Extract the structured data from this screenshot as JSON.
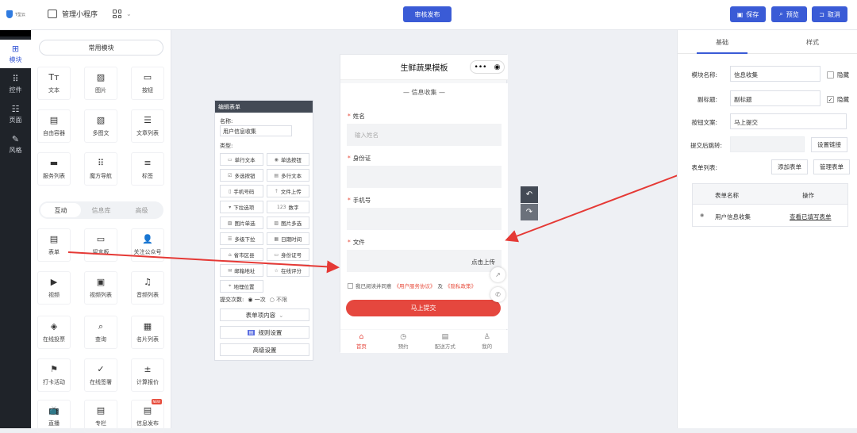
{
  "topbar": {
    "logo_text": "T型云",
    "manage_label": "管理小程序",
    "review_publish_label": "审核发布",
    "save_label": "保存",
    "preview_label": "预览",
    "cancel_label": "取消",
    "accent_color": "#3a5bd6"
  },
  "sidebar": {
    "items": [
      {
        "label": "模块",
        "icon": "plus-square-icon"
      },
      {
        "label": "控件",
        "icon": "grid-icon"
      },
      {
        "label": "页面",
        "icon": "pages-icon"
      },
      {
        "label": "风格",
        "icon": "brush-icon"
      }
    ]
  },
  "modules": {
    "common_label": "常用模块",
    "common": [
      {
        "label": "文本",
        "icon": "text-icon"
      },
      {
        "label": "图片",
        "icon": "image-icon"
      },
      {
        "label": "按钮",
        "icon": "button-icon"
      },
      {
        "label": "自由容器",
        "icon": "container-icon"
      },
      {
        "label": "多图文",
        "icon": "multi-image-icon"
      },
      {
        "label": "文章列表",
        "icon": "article-list-icon"
      },
      {
        "label": "服务列表",
        "icon": "service-list-icon"
      },
      {
        "label": "魔方导航",
        "icon": "cube-nav-icon"
      },
      {
        "label": "标签",
        "icon": "tag-icon"
      }
    ],
    "tabs": [
      "互动",
      "信息库",
      "高级"
    ],
    "interactive": [
      {
        "label": "表单",
        "icon": "form-icon"
      },
      {
        "label": "留言板",
        "icon": "message-icon"
      },
      {
        "label": "关注公众号",
        "icon": "follow-icon"
      },
      {
        "label": "视频",
        "icon": "video-icon"
      },
      {
        "label": "视频列表",
        "icon": "video-list-icon"
      },
      {
        "label": "音频列表",
        "icon": "audio-list-icon"
      },
      {
        "label": "在线投票",
        "icon": "vote-icon"
      },
      {
        "label": "查询",
        "icon": "query-icon"
      },
      {
        "label": "名片列表",
        "icon": "card-list-icon"
      },
      {
        "label": "打卡活动",
        "icon": "checkin-icon"
      },
      {
        "label": "在线签署",
        "icon": "sign-icon"
      },
      {
        "label": "计算报价",
        "icon": "calculator-icon"
      },
      {
        "label": "直播",
        "icon": "live-icon"
      },
      {
        "label": "专栏",
        "icon": "column-icon"
      },
      {
        "label": "信息发布",
        "icon": "publish-icon"
      }
    ],
    "new_badge": "NEW"
  },
  "editor": {
    "title": "编辑表单",
    "name_label": "名称:",
    "name_value": "用户信息收集",
    "type_label": "类型:",
    "types": [
      {
        "label": "单行文本",
        "icon": "input-icon"
      },
      {
        "label": "单选按钮",
        "icon": "radio-icon"
      },
      {
        "label": "多选按钮",
        "icon": "checkbox-icon"
      },
      {
        "label": "多行文本",
        "icon": "textarea-icon"
      },
      {
        "label": "手机号码",
        "icon": "phone-icon"
      },
      {
        "label": "文件上传",
        "icon": "upload-icon"
      },
      {
        "label": "下拉选项",
        "icon": "dropdown-icon"
      },
      {
        "label": "数字",
        "icon": "number-icon"
      },
      {
        "label": "图片单选",
        "icon": "image-radio-icon"
      },
      {
        "label": "图片多选",
        "icon": "image-multi-icon"
      },
      {
        "label": "多级下拉",
        "icon": "cascade-icon"
      },
      {
        "label": "日期时间",
        "icon": "calendar-icon"
      },
      {
        "label": "省市区县",
        "icon": "region-icon"
      },
      {
        "label": "身份证号",
        "icon": "id-card-icon"
      },
      {
        "label": "邮箱地址",
        "icon": "mail-icon"
      },
      {
        "label": "在线评分",
        "icon": "star-icon"
      },
      {
        "label": "地理位置",
        "icon": "location-icon"
      }
    ],
    "submit_times_label": "提交次数:",
    "submit_once": "一次",
    "submit_unlimited": "不限",
    "content_select": "表单项内容",
    "rules_label": "规则设置",
    "advanced_label": "高级设置"
  },
  "phone": {
    "title": "生鲜蔬果模板",
    "section_title": "信息收集",
    "fields": [
      {
        "label": "姓名",
        "placeholder": "输入姓名"
      },
      {
        "label": "身份证",
        "placeholder": ""
      },
      {
        "label": "手机号",
        "placeholder": ""
      },
      {
        "label": "文件",
        "placeholder": ""
      }
    ],
    "upload_label": "点击上传",
    "agree_prefix": "我已阅读并同意",
    "agree_terms": "《用户服务协议》",
    "agree_and": "及",
    "agree_privacy": "《隐私政策》",
    "submit_label": "马上提交",
    "tabbar": [
      {
        "label": "首页",
        "icon": "home-icon"
      },
      {
        "label": "预约",
        "icon": "clock-icon"
      },
      {
        "label": "配送方式",
        "icon": "doc-icon"
      },
      {
        "label": "我的",
        "icon": "user-icon"
      }
    ]
  },
  "right": {
    "tab_basic": "基础",
    "tab_style": "样式",
    "module_name_label": "模块名称:",
    "module_name_value": "信息收集",
    "hide_label": "隐藏",
    "subtitle_label": "副标题:",
    "subtitle_value": "副标题",
    "button_text_label": "按钮文案:",
    "button_text_value": "马上提交",
    "redirect_label": "提交后跳转:",
    "set_link_label": "设置链接",
    "form_list_label": "表单列表:",
    "add_form_label": "添加表单",
    "manage_form_label": "管理表单",
    "table_headers": [
      "表单名称",
      "操作"
    ],
    "table_rows": [
      {
        "name": "用户信息收集",
        "action": "查看已填写表单"
      }
    ]
  }
}
